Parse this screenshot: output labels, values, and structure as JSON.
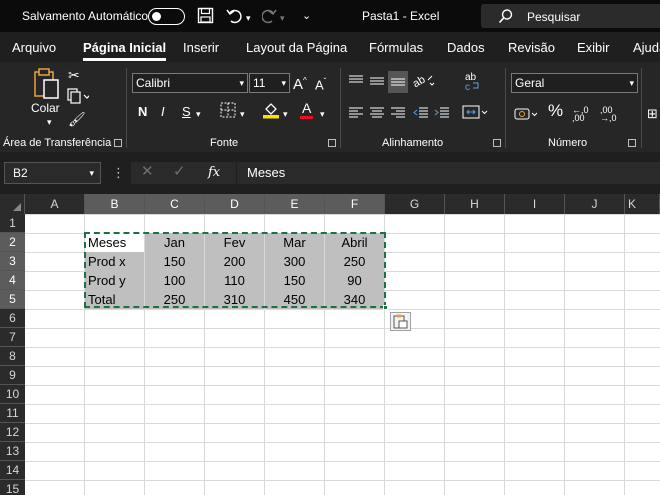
{
  "titlebar": {
    "autosave_label": "Salvamento Automático",
    "document_title": "Pasta1  -  Excel",
    "search_placeholder": "Pesquisar"
  },
  "tabs": [
    {
      "label": "Arquivo"
    },
    {
      "label": "Página Inicial"
    },
    {
      "label": "Inserir"
    },
    {
      "label": "Layout da Página"
    },
    {
      "label": "Fórmulas"
    },
    {
      "label": "Dados"
    },
    {
      "label": "Revisão"
    },
    {
      "label": "Exibir"
    },
    {
      "label": "Ajuda"
    }
  ],
  "ribbon": {
    "clipboard": {
      "paste_label": "Colar",
      "group_label": "Área de Transferência"
    },
    "font": {
      "font_name": "Calibri",
      "font_size": "11",
      "bold": "N",
      "italic": "I",
      "underline": "S",
      "grow": "A",
      "shrink": "A",
      "color_a": "A",
      "group_label": "Fonte"
    },
    "alignment": {
      "group_label": "Alinhamento"
    },
    "number": {
      "format": "Geral",
      "percent": "%",
      "group_label": "Número"
    }
  },
  "formula_bar": {
    "name_box": "B2",
    "fx": "fx",
    "content": "Meses"
  },
  "columns": [
    "A",
    "B",
    "C",
    "D",
    "E",
    "F",
    "G",
    "H",
    "I",
    "J",
    "K"
  ],
  "rows": [
    "1",
    "2",
    "3",
    "4",
    "5",
    "6",
    "7",
    "8",
    "9",
    "10",
    "11",
    "12",
    "13",
    "14",
    "15"
  ],
  "table": [
    [
      "Meses",
      "Jan",
      "Fev",
      "Mar",
      "Abril"
    ],
    [
      "Prod x",
      "150",
      "200",
      "300",
      "250"
    ],
    [
      "Prod y",
      "100",
      "110",
      "150",
      "90"
    ],
    [
      "Total",
      "250",
      "310",
      "450",
      "340"
    ]
  ],
  "colors": {
    "selection_border": "#1e7145",
    "cell_fill": "#bfbfbf",
    "titlebar": "#0b0b0b",
    "ribbon": "#262626"
  }
}
